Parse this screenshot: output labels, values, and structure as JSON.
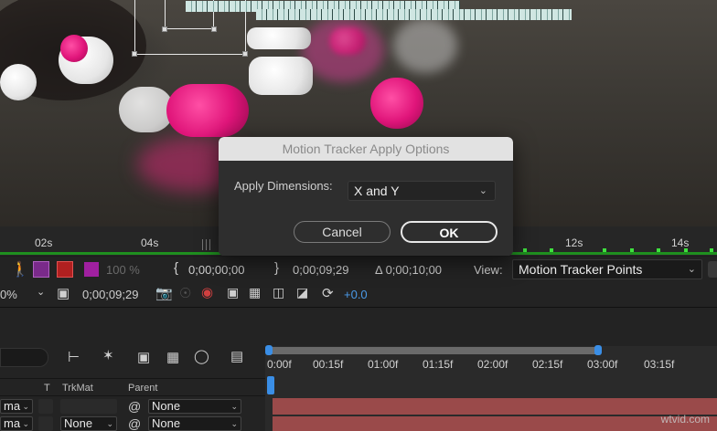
{
  "dialog": {
    "title": "Motion Tracker Apply Options",
    "dimensions_label": "Apply Dimensions:",
    "dimensions_value": "X and Y",
    "cancel_label": "Cancel",
    "ok_label": "OK"
  },
  "time_ruler": {
    "labels": [
      "02s",
      "04s",
      "12s",
      "14s"
    ]
  },
  "toolbar": {
    "opacity_label": "100 %",
    "in_time": "0;00;00;00",
    "out_time": "0;00;09;29",
    "duration": "Δ 0;00;10;00",
    "view_label": "View:",
    "view_value": "Motion Tracker Points"
  },
  "toolbar2": {
    "zoom_value": "0%",
    "current_time": "0;00;09;29",
    "exposure": "+0.0"
  },
  "timeline": {
    "ruler_labels": [
      "0:00f",
      "00:15f",
      "01:00f",
      "01:15f",
      "02:00f",
      "02:15f",
      "03:00f",
      "03:15f"
    ],
    "columns": {
      "t": "T",
      "trkmat": "TrkMat",
      "parent": "Parent"
    },
    "rows": [
      {
        "mode": "ma",
        "trkmat": "",
        "parent": "None"
      },
      {
        "mode": "ma",
        "trkmat": "None",
        "parent": "None"
      }
    ]
  },
  "watermark": "wtvid.com",
  "colors": {
    "accent_blue": "#3a8ee6",
    "green_bar": "#1f8f1f",
    "layer_red": "#9a4a4a",
    "label_purple": "#a020a0"
  }
}
